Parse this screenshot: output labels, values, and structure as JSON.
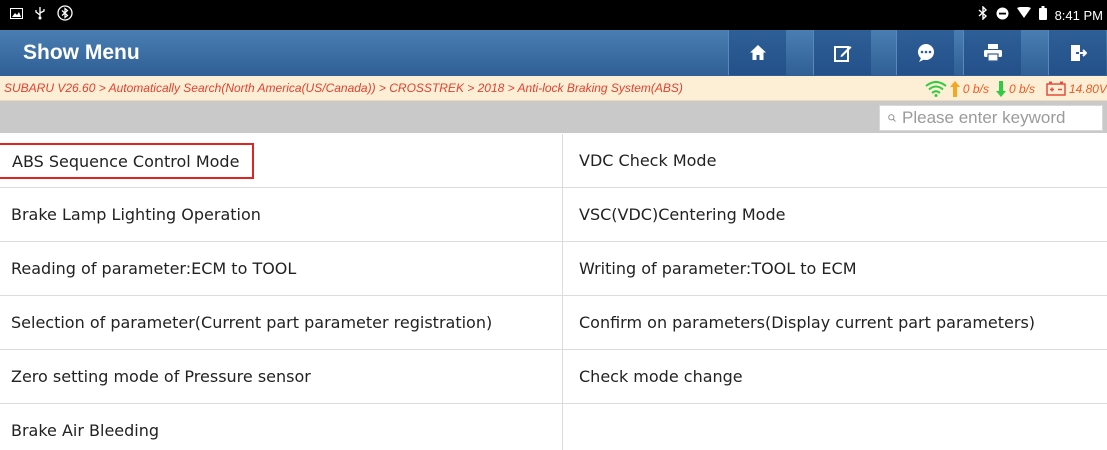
{
  "status_bar": {
    "time": "8:41 PM"
  },
  "header": {
    "title": "Show Menu"
  },
  "toolbar": {
    "buttons": [
      "home-button",
      "edit-button",
      "chat-button",
      "print-button",
      "exit-button"
    ]
  },
  "breadcrumb": "SUBARU V26.60 > Automatically Search(North America(US/Canada)) > CROSSTREK > 2018 > Anti-lock Braking System(ABS)",
  "metrics": {
    "upload": "0 b/s",
    "download": "0 b/s",
    "voltage": "14.80V"
  },
  "search": {
    "placeholder": "Please enter keyword"
  },
  "menu": {
    "items": [
      "ABS Sequence Control Mode",
      "VDC Check Mode",
      "Brake Lamp Lighting Operation",
      "VSC(VDC)Centering Mode",
      "Reading of parameter:ECM to TOOL",
      "Writing of parameter:TOOL to ECM",
      "Selection of parameter(Current part parameter registration)",
      "Confirm on parameters(Display current part parameters)",
      "Zero setting mode of Pressure sensor",
      "Check mode change",
      "Brake Air Bleeding",
      ""
    ]
  },
  "colors": {
    "header": "#3a6ea5",
    "breadcrumb_text": "#e4412e",
    "highlight": "#e02424",
    "wifi": "#2ecc40",
    "upload_arrow": "#f5a623",
    "download_arrow": "#2ecc40"
  }
}
